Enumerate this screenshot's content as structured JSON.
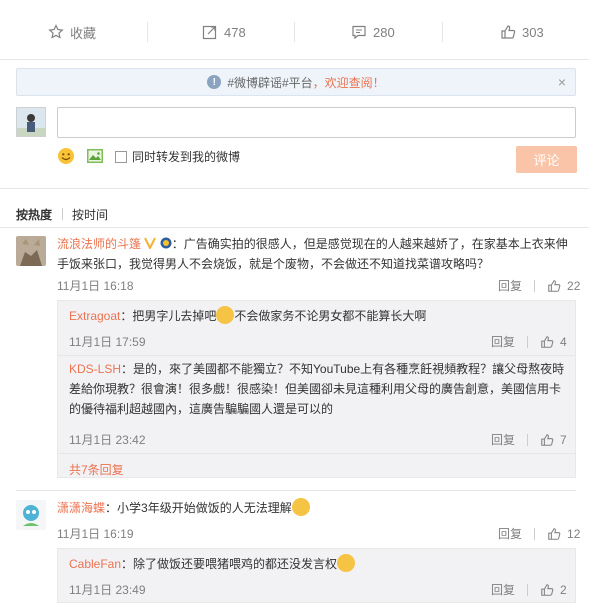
{
  "actions": {
    "collect_label": "收藏",
    "forward_count": "478",
    "comment_count": "280",
    "like_count": "303"
  },
  "notice": {
    "text": "#微博辟谣#平台",
    "link": "，欢迎查阅！",
    "close": "×"
  },
  "composer": {
    "placeholder": "",
    "sync_label": "同时转发到我的微博",
    "submit_label": "评论"
  },
  "sort": {
    "hot": "按热度",
    "time": "按时间"
  },
  "comments": [
    {
      "user": "流浪法师的斗篷",
      "line1": "：广告确实拍的很感人，但是感觉现在的人越来越娇了，在家基本上衣来伸",
      "line2": "手饭来张口，我觉得男人不会烧饭，就是个废物，不会做还不知道找菜谱攻略吗？",
      "time": "11月1日 16:18",
      "reply": "回复",
      "likes": "22",
      "subs": [
        {
          "user": "Extragoat",
          "text_a": "：把男字儿去掉吧",
          "text_b": "不会做家务不论男女都不能算长大啊",
          "time": "11月1日 17:59",
          "reply": "回复",
          "likes": "4"
        },
        {
          "user": "KDS-LSH",
          "line1": "：是的，來了美國都不能獨立？不知YouTube上有各種烹飪視頻教程？讓父母熬夜時",
          "line2": "差給你現教？很會演！很多戲！很感染！但美國卻未見這種利用父母的廣告創意，美國信用卡",
          "line3": "的優待福利超越國內，這廣告騙騙國人還是可以的",
          "time": "11月1日 23:42",
          "reply": "回复",
          "likes": "7"
        }
      ],
      "more": "共7条回复"
    },
    {
      "user": "潇潇海蝶",
      "text": "：小学3年级开始做饭的人无法理解",
      "time": "11月1日 16:19",
      "reply": "回复",
      "likes": "12",
      "subs": [
        {
          "user": "CableFan",
          "text": "：除了做饭还要喂猪喂鸡的都还没发言权",
          "time": "11月1日 23:49",
          "reply": "回复",
          "likes": "2"
        }
      ]
    }
  ]
}
